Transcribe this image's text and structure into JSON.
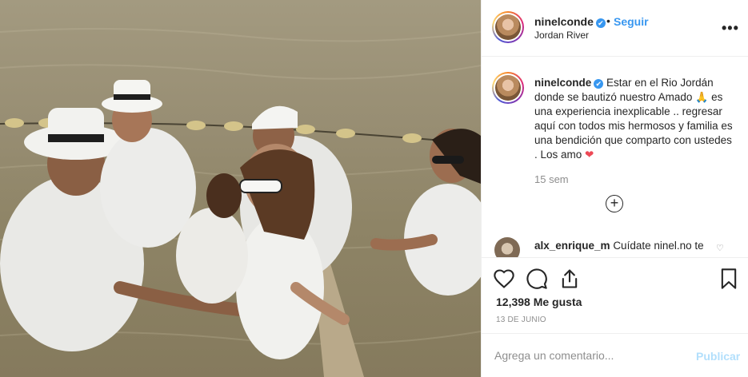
{
  "post": {
    "username": "ninelconde",
    "verified_glyph": "✔",
    "separator": "•",
    "follow_label": "Seguir",
    "location": "Jordan River",
    "more_label": "•••"
  },
  "caption": {
    "username": "ninelconde",
    "text_part1": "Estar en el Rio Jordán donde se bautizó nuestro Amado",
    "pray_emoji": "🙏",
    "text_part2": "es una experiencia inexplicable .. regresar aquí con todos mis hermosos y familia es una bendición que comparto con ustedes . Los amo",
    "heart_emoji": "❤",
    "timestamp": "15 sem",
    "load_more_label": "+"
  },
  "comment": {
    "username": "alx_enrique_m",
    "text": "Cuídate ninel.no te",
    "like_icon": "heart-outline-icon",
    "like_glyph": "♡"
  },
  "actions": {
    "icons": [
      "heart-outline-icon",
      "comment-icon",
      "share-icon",
      "bookmark-icon"
    ],
    "likes_label": "12,398 Me gusta",
    "date": "13 DE JUNIO"
  },
  "add_comment": {
    "placeholder": "Agrega un comentario...",
    "post_label": "Publicar"
  },
  "colors": {
    "link_blue": "#3897f0",
    "muted": "#8e8e8e",
    "publish_disabled": "#b2dffc",
    "heart_red": "#ed4956",
    "divider": "#efefef"
  }
}
